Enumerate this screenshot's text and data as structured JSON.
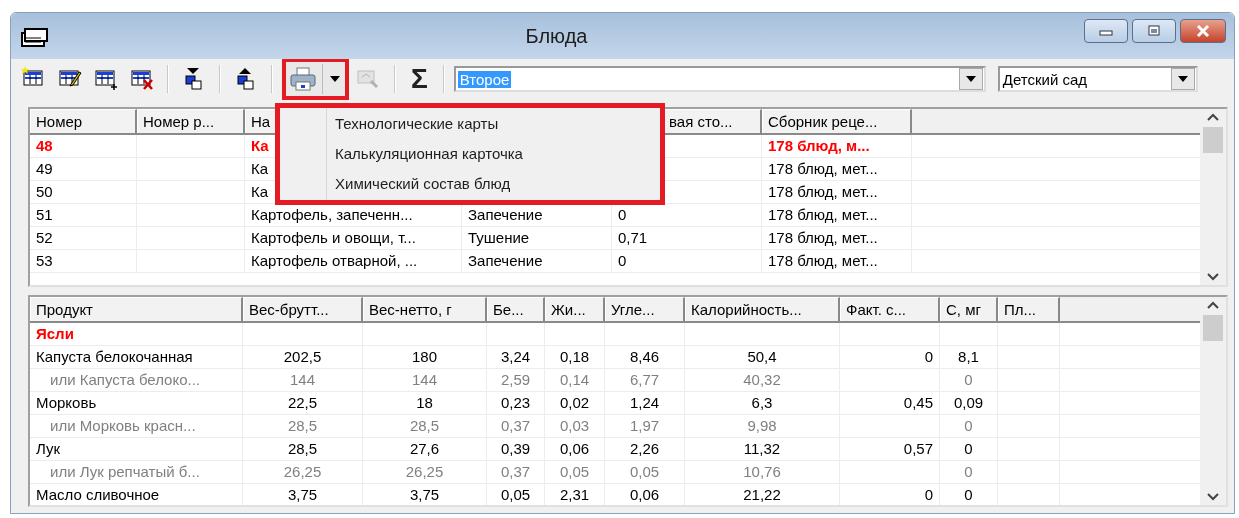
{
  "window": {
    "title": "Блюда"
  },
  "toolbar": {
    "tools": [
      {
        "kind": "new",
        "disabled": false
      },
      {
        "kind": "edit",
        "disabled": false
      },
      {
        "kind": "add",
        "disabled": false
      },
      {
        "kind": "delete",
        "disabled": false
      },
      {
        "kind": "separator"
      },
      {
        "kind": "down",
        "disabled": false
      },
      {
        "kind": "separator"
      },
      {
        "kind": "up",
        "disabled": false
      },
      {
        "kind": "separator"
      },
      {
        "kind": "print",
        "disabled": false
      },
      {
        "kind": "preview",
        "disabled": true
      },
      {
        "kind": "separator"
      },
      {
        "kind": "sum",
        "label": "Σ",
        "disabled": false
      },
      {
        "kind": "separator"
      }
    ],
    "category_combo": {
      "value": "Второе",
      "text_selected": true
    },
    "group_combo": {
      "value": "Детский сад",
      "text_selected": false
    }
  },
  "print_menu": {
    "items": [
      "Технологические карты",
      "Калькуляционная карточка",
      "Химический состав блюд"
    ]
  },
  "dishes_table": {
    "columns": [
      {
        "label": "Номер"
      },
      {
        "label": "Номер р..."
      },
      {
        "label": "На"
      },
      {},
      {
        "label": "вая сто..."
      },
      {
        "label": "Сборник реце..."
      }
    ],
    "rows": [
      {
        "selected": true,
        "cells": [
          "48",
          null,
          "Ка",
          null,
          null,
          "178 блюд, м..."
        ]
      },
      {
        "selected": false,
        "cells": [
          "49",
          null,
          "Ка",
          null,
          null,
          "178 блюд, мет..."
        ]
      },
      {
        "selected": false,
        "cells": [
          "50",
          null,
          "Ка",
          null,
          null,
          "178 блюд, мет..."
        ]
      },
      {
        "selected": false,
        "cells": [
          "51",
          null,
          "Картофель, запеченн...",
          "Запечение",
          "0",
          "178 блюд, мет..."
        ]
      },
      {
        "selected": false,
        "cells": [
          "52",
          null,
          "Картофель и овощи, т...",
          "Тушение",
          "0,71",
          "178 блюд, мет..."
        ]
      },
      {
        "selected": false,
        "cells": [
          "53",
          null,
          "Картофель отварной, ...",
          "Запечение",
          "0",
          "178 блюд, мет..."
        ]
      }
    ]
  },
  "products_table": {
    "columns": [
      {
        "label": "Продукт"
      },
      {
        "label": "Вес-брутт..."
      },
      {
        "label": "Вес-нетто, г"
      },
      {
        "label": "Бе..."
      },
      {
        "label": "Жи..."
      },
      {
        "label": "Угле..."
      },
      {
        "label": "Калорийность..."
      },
      {
        "label": "Факт. с..."
      },
      {
        "label": "С, мг"
      },
      {
        "label": "Пл..."
      }
    ],
    "rows": [
      {
        "kind": "group",
        "cells": [
          "Ясли",
          null,
          null,
          null,
          null,
          null,
          null,
          null,
          null,
          null
        ]
      },
      {
        "kind": "product",
        "cells": [
          "Капуста белокочанная",
          "202,5",
          "180",
          "3,24",
          "0,18",
          "8,46",
          "50,4",
          "0",
          "8,1",
          null
        ]
      },
      {
        "kind": "alternative",
        "cells": [
          "или Капуста белоко...",
          "144",
          "144",
          "2,59",
          "0,14",
          "6,77",
          "40,32",
          null,
          "0",
          null
        ]
      },
      {
        "kind": "product",
        "cells": [
          "Морковь",
          "22,5",
          "18",
          "0,23",
          "0,02",
          "1,24",
          "6,3",
          "0,45",
          "0,09",
          null
        ]
      },
      {
        "kind": "alternative",
        "cells": [
          "или Морковь красн...",
          "28,5",
          "28,5",
          "0,37",
          "0,03",
          "1,97",
          "9,98",
          null,
          "0",
          null
        ]
      },
      {
        "kind": "product",
        "cells": [
          "Лук",
          "28,5",
          "27,6",
          "0,39",
          "0,06",
          "2,26",
          "11,32",
          "0,57",
          "0",
          null
        ]
      },
      {
        "kind": "alternative",
        "cells": [
          "или Лук репчатый б...",
          "26,25",
          "26,25",
          "0,37",
          "0,05",
          "0,05",
          "10,76",
          null,
          "0",
          null
        ]
      },
      {
        "kind": "product",
        "cells": [
          "Масло сливочное",
          "3,75",
          "3,75",
          "0,05",
          "2,31",
          "0,06",
          "21,22",
          "0",
          "0",
          null
        ]
      }
    ]
  }
}
